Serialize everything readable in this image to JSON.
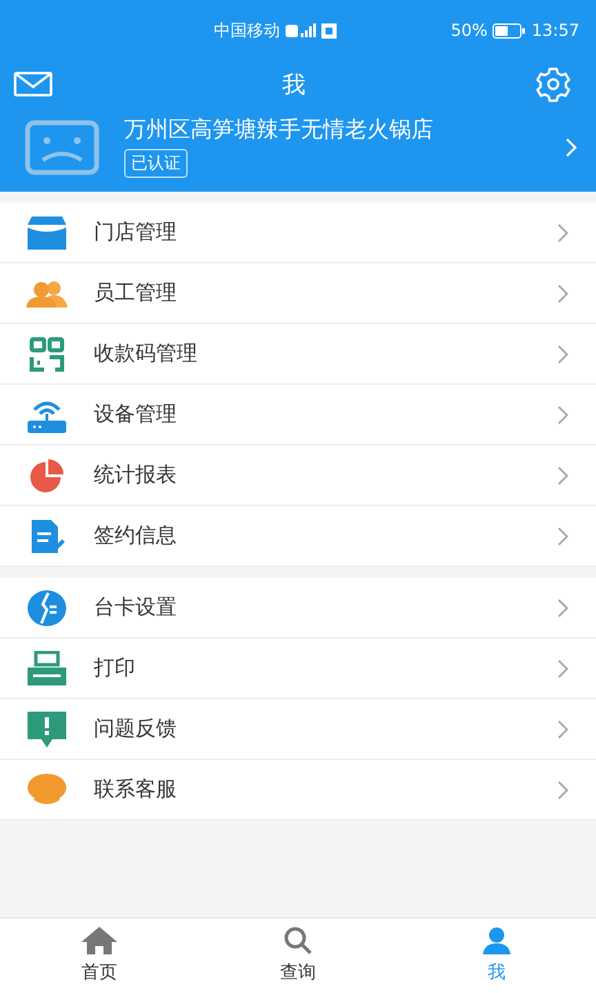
{
  "status_bar": {
    "carrier": "中国移动",
    "battery_percent": "50%",
    "time": "13:57"
  },
  "header": {
    "title": "我"
  },
  "profile": {
    "name": "万州区高笋塘辣手无情老火锅店",
    "badge": "已认证"
  },
  "menu_groups": [
    [
      {
        "kind": "store",
        "label": "门店管理"
      },
      {
        "kind": "staff",
        "label": "员工管理"
      },
      {
        "kind": "qrcode",
        "label": "收款码管理"
      },
      {
        "kind": "device",
        "label": "设备管理"
      },
      {
        "kind": "report",
        "label": "统计报表"
      },
      {
        "kind": "contract",
        "label": "签约信息"
      }
    ],
    [
      {
        "kind": "card",
        "label": "台卡设置"
      },
      {
        "kind": "print",
        "label": "打印"
      },
      {
        "kind": "feedback",
        "label": "问题反馈"
      },
      {
        "kind": "service",
        "label": "联系客服"
      }
    ]
  ],
  "tab_bar": [
    {
      "kind": "home",
      "label": "首页",
      "selected": false
    },
    {
      "kind": "search",
      "label": "查询",
      "selected": false
    },
    {
      "kind": "me",
      "label": "我",
      "selected": true
    }
  ]
}
